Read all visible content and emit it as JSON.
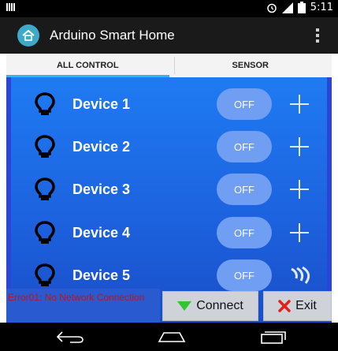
{
  "status_bar": {
    "time": "5:11",
    "icons": [
      "notification-icon",
      "alarm-icon",
      "signal-icon",
      "battery-icon"
    ]
  },
  "action_bar": {
    "title": "Arduino Smart Home",
    "icons": [
      "app-home-icon",
      "overflow-menu-icon"
    ]
  },
  "tabs": [
    {
      "label": "ALL CONTROL",
      "active": true
    },
    {
      "label": "SENSOR",
      "active": false
    }
  ],
  "devices": [
    {
      "label": "Device 1",
      "state": "OFF",
      "action_icon": "plus-icon"
    },
    {
      "label": "Device 2",
      "state": "OFF",
      "action_icon": "plus-icon"
    },
    {
      "label": "Device 3",
      "state": "OFF",
      "action_icon": "plus-icon"
    },
    {
      "label": "Device 4",
      "state": "OFF",
      "action_icon": "plus-icon"
    },
    {
      "label": "Device 5",
      "state": "OFF",
      "action_icon": "wave-icon"
    }
  ],
  "footer": {
    "error_text": "Error01: No Network Connection",
    "connect_label": "Connect",
    "exit_label": "Exit"
  },
  "nav_bar": {
    "icons": [
      "back-icon",
      "home-icon",
      "recent-apps-icon"
    ]
  },
  "colors": {
    "panel_blue": "#1d63e0",
    "tab_indicator": "#33b5e5",
    "error_text": "#c0121a",
    "toggle_off": "#6f9ef3"
  }
}
